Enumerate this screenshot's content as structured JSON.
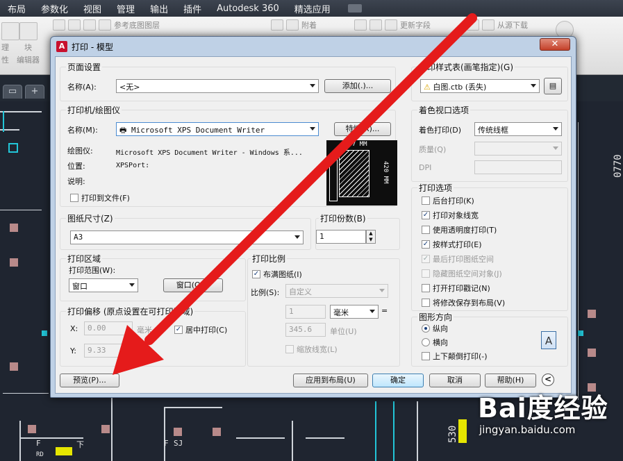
{
  "app": {
    "menu": [
      "布局",
      "参数化",
      "视图",
      "管理",
      "输出",
      "插件",
      "Autodesk 360",
      "精选应用"
    ],
    "ribbon": {
      "labels": [
        "参考底图图层",
        "附着",
        "更新字段",
        "从源下载"
      ],
      "left_panel": [
        "理",
        "性",
        "块",
        "编辑器"
      ]
    },
    "canvas_labels": {
      "top_right_vertical": "0770",
      "bottom_vertical": "530",
      "marks_f": "F",
      "marks_down": "下",
      "marks_sj": "SJ",
      "marks_f2": "F",
      "marks_rd": "RD"
    },
    "colors": {
      "dialog_bg": "#f0f0f0",
      "arrow": "#e51b1b",
      "title_frame": "#bfd1e6"
    }
  },
  "dialog": {
    "title": "打印 - 模型",
    "close_label": "✕",
    "page_setup": {
      "legend": "页面设置",
      "name_label": "名称(A):",
      "name_value": "<无>",
      "add_button": "添加(.)..."
    },
    "printer": {
      "legend": "打印机/绘图仪",
      "name_label": "名称(M):",
      "name_value": "Microsoft XPS Document Writer",
      "properties_button": "特性(R)...",
      "plotter_label": "绘图仪:",
      "plotter_value": "Microsoft XPS Document Writer - Windows 系...",
      "location_label": "位置:",
      "location_value": "XPSPort:",
      "description_label": "说明:",
      "print_to_file": "打印到文件(F)",
      "preview_width": "297 MM",
      "preview_height": "420 MM"
    },
    "paper_size": {
      "legend": "图纸尺寸(Z)",
      "value": "A3"
    },
    "copies": {
      "legend": "打印份数(B)",
      "value": "1"
    },
    "plot_area": {
      "legend": "打印区域",
      "range_label": "打印范围(W):",
      "range_value": "窗口",
      "window_button": "窗口(O)<"
    },
    "plot_offset": {
      "legend": "打印偏移 (原点设置在可打印区域)",
      "x_label": "X:",
      "x_value": "0.00",
      "x_unit": "毫米",
      "y_label": "Y:",
      "y_value": "9.33",
      "y_unit": "毫米",
      "center": "居中打印(C)"
    },
    "plot_scale": {
      "legend": "打印比例",
      "fit_to_paper": "布满图纸(I)",
      "scale_label": "比例(S):",
      "scale_value": "自定义",
      "value1": "1",
      "unit_value": "毫米",
      "equals": "=",
      "value2": "345.6",
      "unit2": "单位(U)",
      "scale_lineweights": "缩放线宽(L)"
    },
    "style_table": {
      "legend": "打印样式表(画笔指定)(G)",
      "value": "白图.ctb (丢失)"
    },
    "shaded_viewport": {
      "legend": "着色视口选项",
      "shade_label": "着色打印(D)",
      "shade_value": "传统线框",
      "quality_label": "质量(Q)",
      "dpi_label": "DPI"
    },
    "plot_options": {
      "legend": "打印选项",
      "items": [
        {
          "label": "后台打印(K)",
          "checked": false,
          "disabled": false
        },
        {
          "label": "打印对象线宽",
          "checked": true,
          "disabled": false
        },
        {
          "label": "使用透明度打印(T)",
          "checked": false,
          "disabled": false
        },
        {
          "label": "按样式打印(E)",
          "checked": true,
          "disabled": false
        },
        {
          "label": "最后打印图纸空间",
          "checked": true,
          "disabled": true
        },
        {
          "label": "隐藏图纸空间对象(J)",
          "checked": false,
          "disabled": true
        },
        {
          "label": "打开打印戳记(N)",
          "checked": false,
          "disabled": false
        },
        {
          "label": "将修改保存到布局(V)",
          "checked": false,
          "disabled": false
        }
      ]
    },
    "orientation": {
      "legend": "图形方向",
      "portrait": "纵向",
      "landscape": "横向",
      "upside_down": "上下颠倒打印(-)",
      "paper_icon_letter": "A"
    },
    "buttons": {
      "preview": "预览(P)...",
      "apply_layout": "应用到布局(U)",
      "ok": "确定",
      "cancel": "取消",
      "help": "帮助(H)",
      "expand": "<"
    }
  },
  "watermark": {
    "brand": "Bai度经验",
    "url": "jingyan.baidu.com"
  }
}
